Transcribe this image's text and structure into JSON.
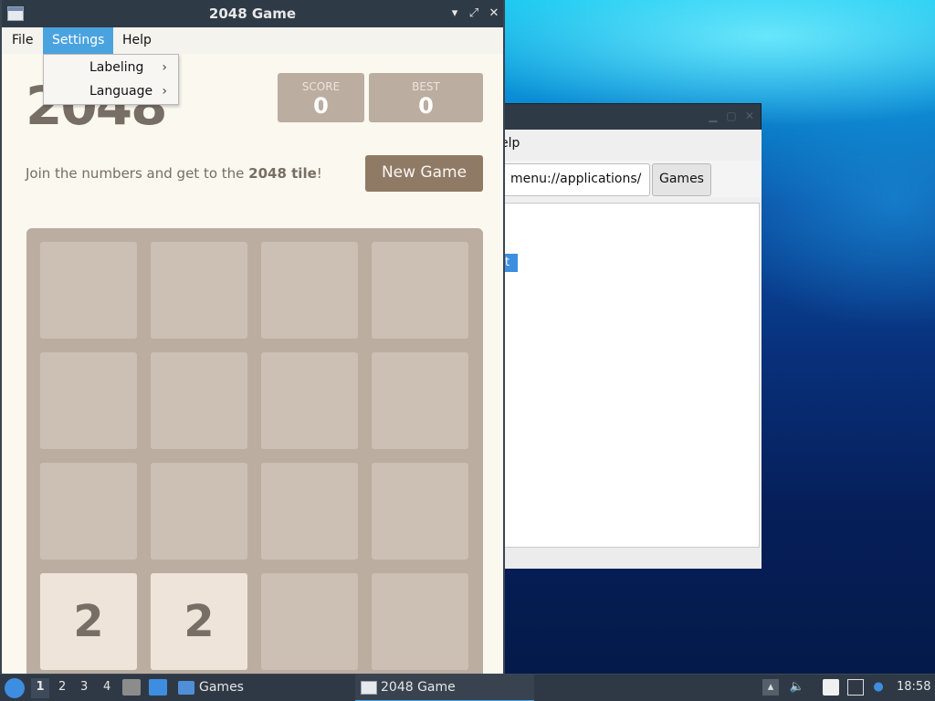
{
  "desktop": {},
  "fm_window": {
    "menu_help": "elp",
    "path": "menu://applications/",
    "games_button": "Games",
    "selected_item": "t"
  },
  "game_window": {
    "title": "2048 Game",
    "menus": [
      "File",
      "Settings",
      "Help"
    ],
    "settings_menu": [
      "Labeling",
      "Language"
    ],
    "heading": "2048",
    "score_label": "SCORE",
    "score_value": "0",
    "best_label": "BEST",
    "best_value": "0",
    "intro_before": "Join the numbers and get to the ",
    "intro_bold": "2048 tile",
    "intro_after": "!",
    "new_game": "New Game",
    "board": [
      [
        "",
        "",
        "",
        ""
      ],
      [
        "",
        "",
        "",
        ""
      ],
      [
        "",
        "",
        "",
        ""
      ],
      [
        "2",
        "2",
        "",
        ""
      ]
    ]
  },
  "taskbar": {
    "workspaces": [
      "1",
      "2",
      "3",
      "4"
    ],
    "task_games": "Games",
    "task_2048": "2048 Game",
    "clock": "18:58"
  },
  "colors": {
    "board": "#bbada0",
    "tile_2": "#eee4da",
    "accent": "#4aa3df",
    "new_game_bg": "#8f7a66"
  },
  "icons": [
    "start-menu-icon",
    "file-manager-icon",
    "desktop-icon",
    "folder-icon",
    "window-icon",
    "updates-icon",
    "volume-icon",
    "clipboard-icon",
    "network-icon",
    "notification-icon",
    "minimize-icon",
    "maximize-icon",
    "close-icon",
    "chevron-right-icon"
  ]
}
